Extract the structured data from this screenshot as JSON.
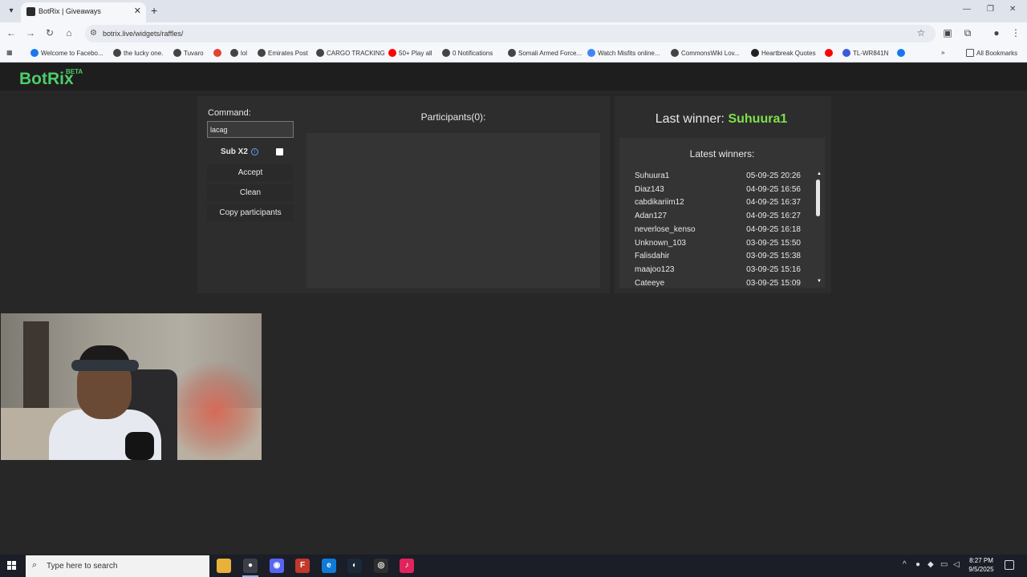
{
  "browser": {
    "tab_title": "BotRix | Giveaways",
    "url": "botrix.live/widgets/raffles/",
    "bookmarks": [
      {
        "label": "Welcome to Facebo...",
        "icon": "facebook-icon",
        "color": "#1877f2"
      },
      {
        "label": "the lucky one.",
        "icon": "globe-icon",
        "color": "#444444"
      },
      {
        "label": "Tuvaro",
        "icon": "globe-icon",
        "color": "#444444"
      },
      {
        "label": "",
        "icon": "gmail-icon",
        "color": "#e34133"
      },
      {
        "label": "lol",
        "icon": "globe-icon",
        "color": "#444444"
      },
      {
        "label": "Emirates Post",
        "icon": "globe-icon",
        "color": "#444444"
      },
      {
        "label": "CARGO TRACKING",
        "icon": "globe-icon",
        "color": "#444444"
      },
      {
        "label": "50+ Play all",
        "icon": "youtube-icon",
        "color": "#ff0000"
      },
      {
        "label": "0 Notifications",
        "icon": "globe-icon",
        "color": "#444444"
      },
      {
        "label": "Somali Armed Force...",
        "icon": "globe-icon",
        "color": "#444444"
      },
      {
        "label": "Watch Misfits online...",
        "icon": "google-icon",
        "color": "#4285f4"
      },
      {
        "label": "CommonsWiki Lov...",
        "icon": "globe-icon",
        "color": "#444444"
      },
      {
        "label": "Heartbreak Quotes",
        "icon": "globe-icon",
        "color": "#222222"
      },
      {
        "label": "",
        "icon": "youtube-icon",
        "color": "#ff0000"
      },
      {
        "label": "TL-WR841N",
        "icon": "globe-icon",
        "color": "#3a5bd9"
      },
      {
        "label": "",
        "icon": "facebook-icon",
        "color": "#1877f2"
      }
    ],
    "all_bookmarks": "All Bookmarks"
  },
  "app": {
    "logo": "BotRix",
    "beta": "BETA",
    "accent": "#4ccd6a"
  },
  "raffle": {
    "command_label": "Command:",
    "command_value": "lacag",
    "sub_x2_label": "Sub X2",
    "sub_x2_checked": false,
    "accept_label": "Accept",
    "clean_label": "Clean",
    "copy_label": "Copy participants",
    "participants_title": "Participants(0):"
  },
  "winners": {
    "last_winner_label": "Last winner:",
    "last_winner_name": "Suhuura1",
    "latest_title": "Latest winners:",
    "list": [
      {
        "name": "Suhuura1",
        "date": "05-09-25 20:26"
      },
      {
        "name": "Diaz143",
        "date": "04-09-25 16:56"
      },
      {
        "name": "cabdikariim12",
        "date": "04-09-25 16:37"
      },
      {
        "name": "Adan127",
        "date": "04-09-25 16:27"
      },
      {
        "name": "neverlose_kenso",
        "date": "04-09-25 16:18"
      },
      {
        "name": "Unknown_103",
        "date": "03-09-25 15:50"
      },
      {
        "name": "Falisdahir",
        "date": "03-09-25 15:38"
      },
      {
        "name": "maajoo123",
        "date": "03-09-25 15:16"
      },
      {
        "name": "Cateeye",
        "date": "03-09-25 15:09"
      }
    ]
  },
  "taskbar": {
    "search_placeholder": "Type here to search",
    "time": "8:27 PM",
    "date": "9/5/2025"
  }
}
